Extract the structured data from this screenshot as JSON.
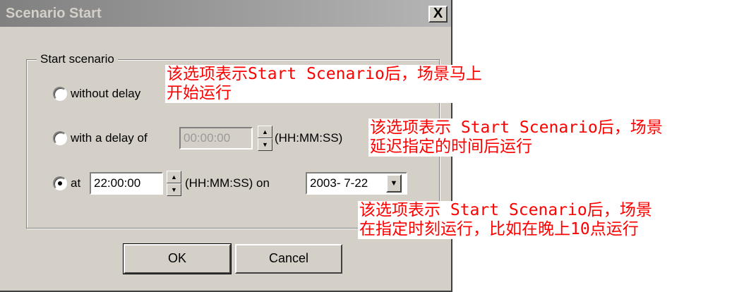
{
  "dialog": {
    "title": "Scenario Start",
    "close_symbol": "X",
    "group_label": "Start scenario",
    "options": [
      {
        "label": "without delay",
        "selected": false
      },
      {
        "label_prefix": "with a delay of",
        "value": "00:00:00",
        "format": "(HH:MM:SS)",
        "selected": false
      },
      {
        "label_prefix": "at",
        "value": "22:00:00",
        "format": "(HH:MM:SS) on",
        "date": "2003- 7-22",
        "selected": true
      }
    ],
    "ok_label": "OK",
    "cancel_label": "Cancel"
  },
  "annotations": [
    {
      "line1": "该选项表示Start Scenario后，场景马上",
      "line2": "开始运行"
    },
    {
      "line1": "该选项表示 Start Scenario后，场景",
      "line2": "延迟指定的时间后运行"
    },
    {
      "line1": "该选项表示 Start Scenario后，场景",
      "line2": "在指定时刻运行，比如在晚上10点运行"
    }
  ],
  "colors": {
    "dialog_bg": "#d4d0c8",
    "annotation_text": "#ff0000",
    "title_gradient_start": "#808080"
  }
}
